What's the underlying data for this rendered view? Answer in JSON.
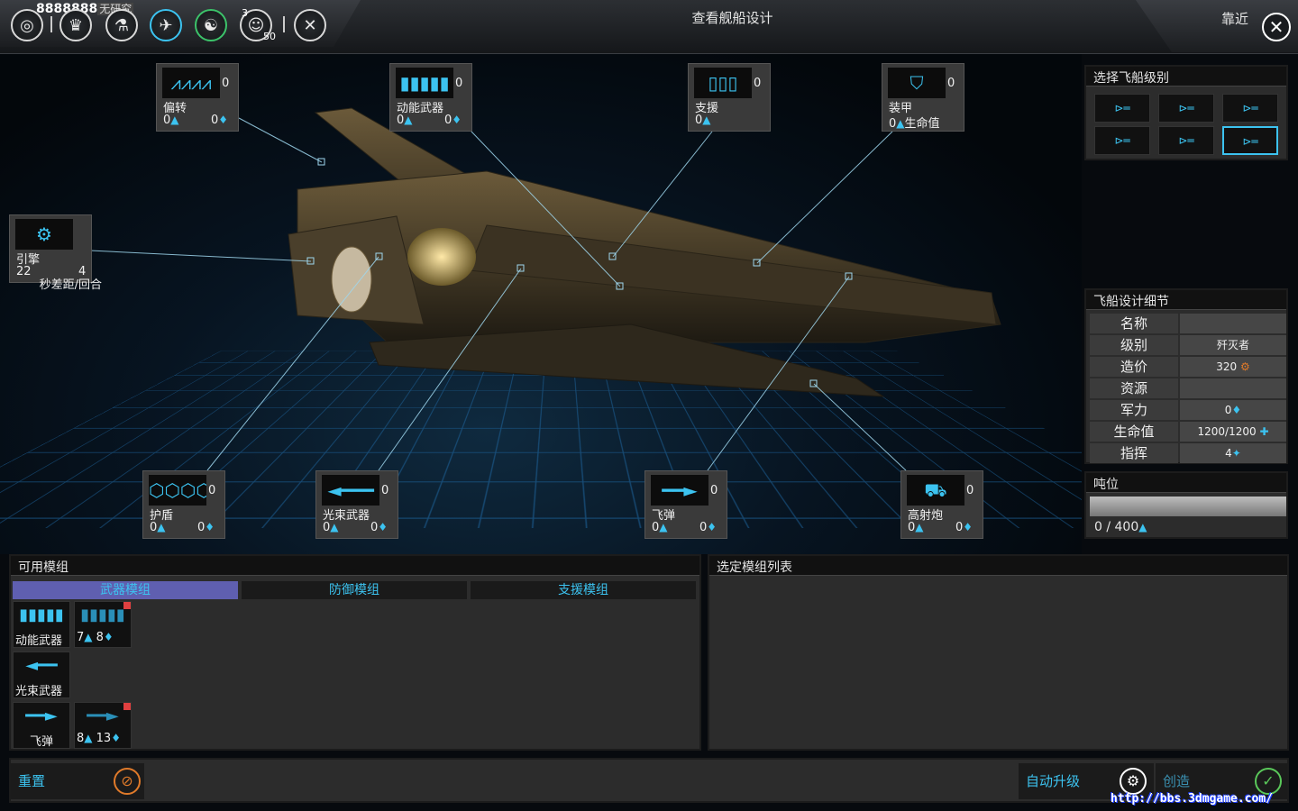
{
  "topbar": {
    "credits": "8888888",
    "research": "无研究",
    "badge_a": "3",
    "badge_b": "50",
    "title": "查看舰船设计",
    "zoom_label": "靠近",
    "icons": [
      "galaxy-icon",
      "empire-icon",
      "research-icon",
      "ships-icon",
      "diplomacy-icon",
      "population-icon",
      "settings-icon"
    ]
  },
  "modules": {
    "deflector": {
      "name": "偏转",
      "count": "0",
      "v1": "0",
      "v2": "0"
    },
    "kinetic": {
      "name": "动能武器",
      "count": "0",
      "v1": "0",
      "v2": "0"
    },
    "support": {
      "name": "支援",
      "count": "0",
      "v1": "0"
    },
    "armor": {
      "name": "装甲",
      "count": "0",
      "v1": "0",
      "extra": "生命值"
    },
    "engine": {
      "name": "引擎",
      "v1": "22",
      "v2": "4",
      "extra": "秒差距/回合"
    },
    "shield": {
      "name": "护盾",
      "count": "0",
      "v1": "0",
      "v2": "0"
    },
    "beam": {
      "name": "光束武器",
      "count": "0",
      "v1": "0",
      "v2": "0"
    },
    "missile": {
      "name": "飞弹",
      "count": "0",
      "v1": "0",
      "v2": "0"
    },
    "artillery": {
      "name": "高射炮",
      "count": "0",
      "v1": "0",
      "v2": "0"
    }
  },
  "ship_class": {
    "title": "选择飞船级别",
    "selected_index": 5
  },
  "details": {
    "title": "飞船设计细节",
    "rows": [
      {
        "label": "名称",
        "value": ""
      },
      {
        "label": "级别",
        "value": "歼灭者"
      },
      {
        "label": "造价",
        "value": "320"
      },
      {
        "label": "资源",
        "value": ""
      },
      {
        "label": "军力",
        "value": "0"
      },
      {
        "label": "生命值",
        "value": "1200/1200"
      },
      {
        "label": "指挥",
        "value": "4"
      }
    ]
  },
  "tonnage": {
    "title": "吨位",
    "value": "0 / 400",
    "fill": 0
  },
  "available": {
    "title": "可用模组",
    "tabs": [
      "武器模组",
      "防御模组",
      "支援模组"
    ],
    "active_tab": 0,
    "items": [
      {
        "label": "动能武器"
      },
      {
        "label": "7",
        "label2": "8"
      },
      {
        "label": "光束武器"
      },
      {
        "label": "飞弹"
      },
      {
        "label": "8",
        "label2": "13"
      }
    ]
  },
  "selected_list": {
    "title": "选定模组列表"
  },
  "bottom": {
    "reset": "重置",
    "auto_upgrade": "自动升级",
    "create": "创造"
  },
  "watermark": "http://bbs.3dmgame.com/",
  "colors": {
    "accent": "#3cc3f0",
    "tab_active": "#5f5fb0",
    "cost_icon": "#e07a2a",
    "create_check": "#5ac85a"
  }
}
